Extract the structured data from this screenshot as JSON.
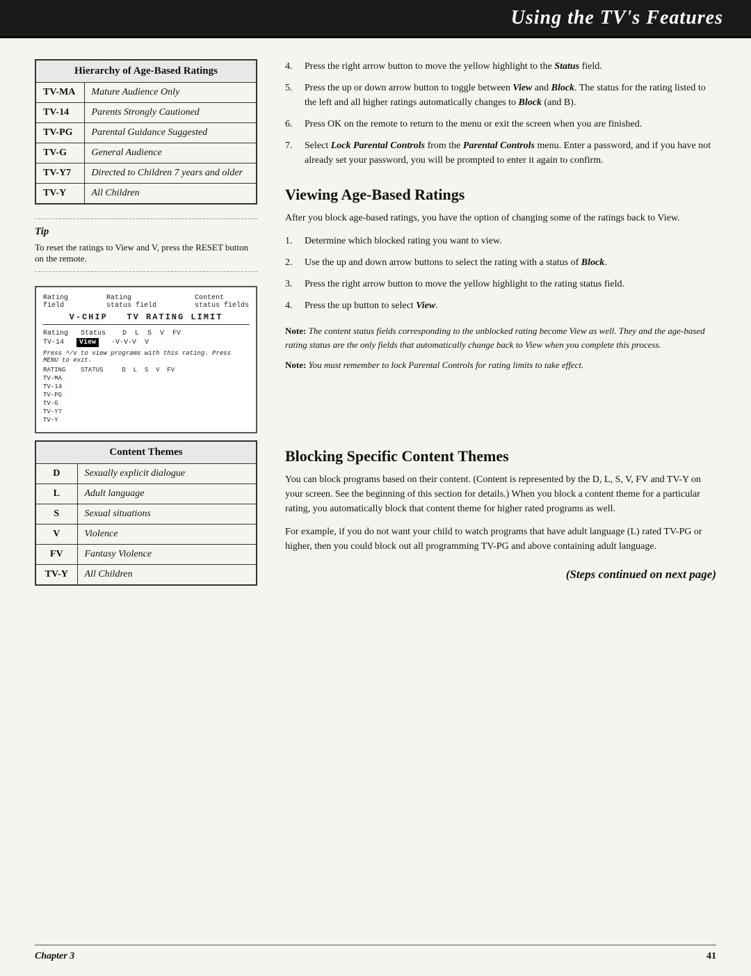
{
  "header": {
    "title": "Using the TV's Features"
  },
  "ageRatingsTable": {
    "heading": "Hierarchy of Age-Based Ratings",
    "rows": [
      {
        "code": "TV-MA",
        "description": "Mature Audience Only"
      },
      {
        "code": "TV-14",
        "description": "Parents Strongly Cautioned"
      },
      {
        "code": "TV-PG",
        "description": "Parental Guidance Suggested"
      },
      {
        "code": "TV-G",
        "description": "General Audience"
      },
      {
        "code": "TV-Y7",
        "description": "Directed to Children 7 years and older"
      },
      {
        "code": "TV-Y",
        "description": "All Children"
      }
    ]
  },
  "tip": {
    "label": "Tip",
    "text": "To reset the ratings to View and V, press the RESET button on the remote."
  },
  "rightColumn": {
    "steps": [
      {
        "num": "4.",
        "text": "Press the right arrow button to move the yellow highlight to the Status field."
      },
      {
        "num": "5.",
        "text": "Press the up or down arrow button to toggle between View and Block. The status for the rating listed to the left and all higher ratings automatically changes to Block (and B)."
      },
      {
        "num": "6.",
        "text": "Press OK on the remote to return to the menu or exit the screen when you are finished."
      },
      {
        "num": "7.",
        "text": "Select Lock Parental Controls from the Parental Controls menu. Enter a password, and if you have not already set your password, you will be prompted to enter it again to confirm."
      }
    ]
  },
  "viewingSection": {
    "heading": "Viewing Age-Based Ratings",
    "intro": "After you block age-based ratings, you have the option of changing some of the ratings back to View.",
    "steps": [
      {
        "num": "1.",
        "text": "Determine which blocked rating you want to view."
      },
      {
        "num": "2.",
        "text": "Use the up and down arrow buttons to select the rating with a status of Block."
      },
      {
        "num": "3.",
        "text": "Press the right arrow button to move the yellow highlight to the rating status field."
      },
      {
        "num": "4.",
        "text": "Press the up button to select View."
      }
    ],
    "note1": "Note:  The content status fields corresponding to the unblocked rating become View as well. They and the age-based rating status are the only fields that automatically change back to View when you complete this process.",
    "note2": "Note:  You must remember to lock Parental Controls for rating limits to take effect."
  },
  "blockingSection": {
    "heading": "Blocking Specific Content Themes",
    "para1": "You can block programs based on their content. (Content is represented by the D, L, S, V, FV and TV-Y on your screen. See the beginning of this section for details.) When you block a content theme for a particular rating, you automatically block that content theme for higher rated programs as well.",
    "para2": "For example, if you do not want your child to watch programs that have adult language (L) rated TV-PG or higher, then you could block out all programming TV-PG and above containing adult language.",
    "stepsLabel": "(Steps continued on next page)"
  },
  "contentThemesTable": {
    "heading": "Content Themes",
    "rows": [
      {
        "code": "D",
        "description": "Sexually explicit dialogue"
      },
      {
        "code": "L",
        "description": "Adult language"
      },
      {
        "code": "S",
        "description": "Sexual situations"
      },
      {
        "code": "V",
        "description": "Violence"
      },
      {
        "code": "FV",
        "description": "Fantasy Violence"
      },
      {
        "code": "TV-Y",
        "description": "All Children"
      }
    ]
  },
  "footer": {
    "chapter": "Chapter 3",
    "page": "41"
  },
  "screenImage": {
    "colLabels": [
      "Rating",
      "Rating",
      "Content"
    ],
    "colSubLabels": [
      "field",
      "status field",
      "status fields"
    ],
    "title": "V-CHIP  TV RATING LIMIT",
    "ratingRow": "Rating     Status    D  L  S  V  FV",
    "tv14Row": "TV-14",
    "viewHighlight": "View",
    "checkboxes": "·V·V·V  V",
    "note": "Press ^/v to view programs with this rating. Press MENU to exit.",
    "statusRows": [
      "RATING     STATUS    D  L  S  V  FV",
      "TV-MA",
      "TV-14",
      "TV-PG",
      "TV-G",
      "TV-Y7",
      "TV-Y"
    ]
  }
}
